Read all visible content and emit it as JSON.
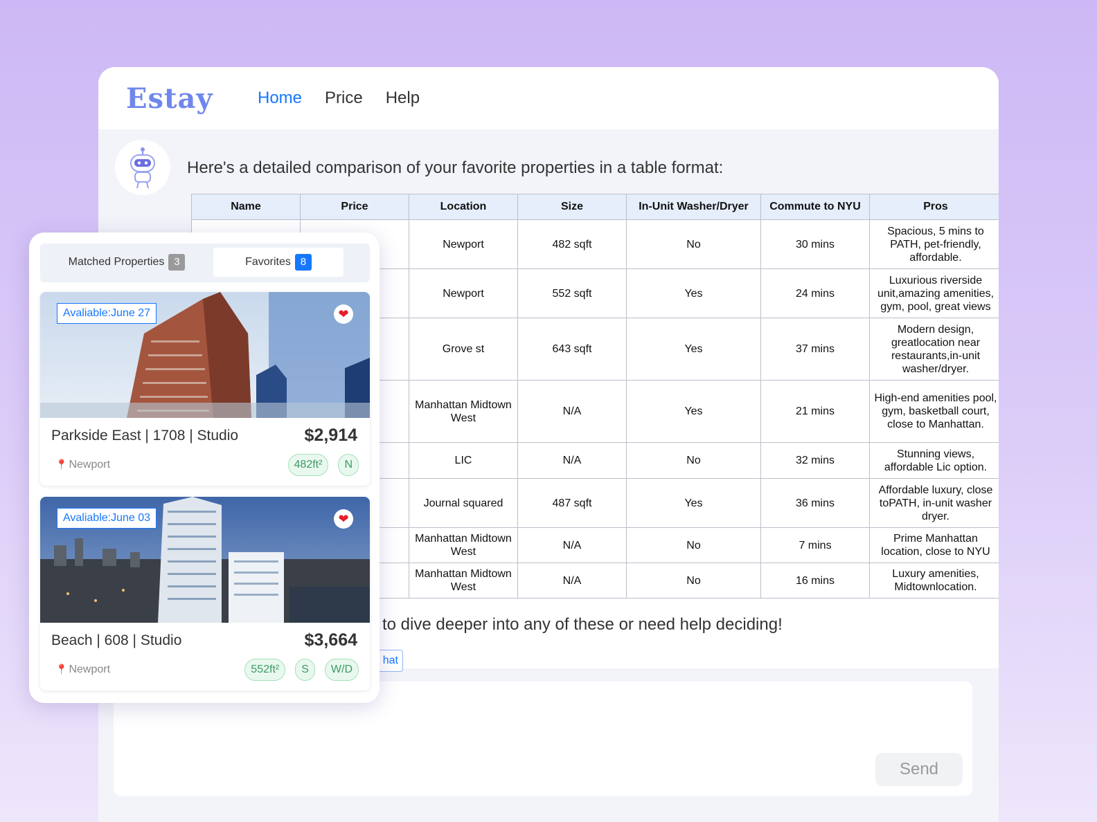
{
  "app": {
    "logo": "Estay"
  },
  "nav": [
    {
      "label": "Home",
      "active": true
    },
    {
      "label": "Price",
      "active": false
    },
    {
      "label": "Help",
      "active": false
    }
  ],
  "chat": {
    "intro": "Here's a detailed comparison of your favorite properties in a table format:",
    "followup": "to dive deeper into any of these or need help deciding!",
    "chip_partial": "hat",
    "send_label": "Send"
  },
  "table": {
    "headers": [
      "Name",
      "Price",
      "Location",
      "Size",
      "In-Unit Washer/Dryer",
      "Commute to NYU",
      "Pros"
    ],
    "rows": [
      {
        "name": "",
        "price": "",
        "location": "Newport",
        "size": "482 sqft",
        "washer": "No",
        "commute": "30 mins",
        "pros": "Spacious, 5 mins to PATH, pet-friendly, affordable."
      },
      {
        "name": "",
        "price": "",
        "location": "Newport",
        "size": "552 sqft",
        "washer": "Yes",
        "commute": "24 mins",
        "pros": "Luxurious riverside unit,amazing amenities, gym, pool, great views"
      },
      {
        "name": "",
        "price": "",
        "location": "Grove st",
        "size": "643 sqft",
        "washer": "Yes",
        "commute": "37 mins",
        "pros": "Modern design, greatlocation near restaurants,in-unit washer/dryer."
      },
      {
        "name": "",
        "price": "",
        "location": "Manhattan Midtown West",
        "size": "N/A",
        "washer": "Yes",
        "commute": "21 mins",
        "pros": "High-end amenities pool, gym, basketball court, close to Manhattan."
      },
      {
        "name": "",
        "price": "",
        "location": "LIC",
        "size": "N/A",
        "washer": "No",
        "commute": "32 mins",
        "pros": "Stunning views, affordable Lic option."
      },
      {
        "name": "",
        "price": "",
        "location": "Journal squared",
        "size": "487 sqft",
        "washer": "Yes",
        "commute": "36 mins",
        "pros": "Affordable luxury, close toPATH, in-unit washer dryer."
      },
      {
        "name": "",
        "price": "",
        "location": "Manhattan Midtown West",
        "size": "N/A",
        "washer": "No",
        "commute": "7 mins",
        "pros": "Prime Manhattan location, close to NYU"
      },
      {
        "name": "",
        "price": "",
        "location": "Manhattan Midtown West",
        "size": "N/A",
        "washer": "No",
        "commute": "16 mins",
        "pros": "Luxury amenities, Midtownlocation."
      }
    ]
  },
  "panel": {
    "tabs": [
      {
        "label": "Matched Properties",
        "count": "3",
        "active": false
      },
      {
        "label": "Favorites",
        "count": "8",
        "active": true
      }
    ],
    "cards": [
      {
        "availability": "Avaliable:June 27",
        "title": "Parkside East | 1708 | Studio",
        "price": "$2,914",
        "location": "Newport",
        "tags": [
          "482ft²",
          "N"
        ],
        "favorited": true
      },
      {
        "availability": "Avaliable:June 03",
        "title": "Beach | 608 | Studio",
        "price": "$3,664",
        "location": "Newport",
        "tags": [
          "552ft²",
          "S",
          "W/D"
        ],
        "favorited": true
      }
    ]
  },
  "colors": {
    "accent": "#1677ff",
    "logo": "#6f87ec",
    "heart": "#e81c2b",
    "tag_green": "#3c9a63"
  },
  "icons": [
    "robot-avatar-icon",
    "heart-icon",
    "location-pin-icon"
  ]
}
